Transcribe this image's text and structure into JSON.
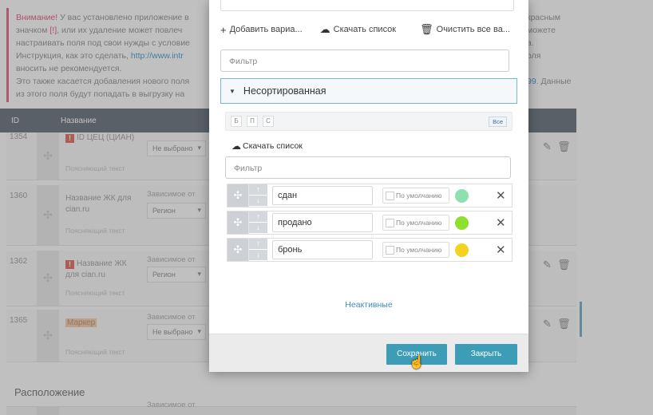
{
  "notice": {
    "warning": "Внимание!",
    "line1": " У вас установлено приложение в",
    "line2_a": "значком ",
    "line2_mark": "[!]",
    "line2_b": ", или их удаление может повлеч",
    "line3": "настраивать поля под свои нужды с условие",
    "line4_a": "Инструкция, как это сделать, ",
    "line4_link": "http://www.intr",
    "line5": "вносить не рекомендуется.",
    "line6": "Это также касается добавления нового поля",
    "line7": "из этого поля будут попадать в выгрузку на",
    "right1": "красным",
    "right2": "можете",
    "right3": "а.",
    "right4": "оля",
    "right6_link": "99",
    "right6": ". Данные"
  },
  "table": {
    "col_id": "ID",
    "col_name": "Название",
    "rows": [
      {
        "id": "1354",
        "name": "ID ЦЕЦ (ЦИАН)",
        "hint": "Поясняющий текст",
        "select": "Не выбрано"
      },
      {
        "id": "1360",
        "name": "Название ЖК для cian.ru",
        "hint": "Поясняющий текст",
        "dep": "Зависимое от",
        "select": "Регион"
      },
      {
        "id": "1362",
        "name": "Название ЖК для cian.ru",
        "hint": "Поясняющий текст",
        "dep": "Зависимое от",
        "select": "Регион"
      },
      {
        "id": "1365",
        "name": "Маркер",
        "hint": "Поясняющий текст",
        "dep": "Зависимое от",
        "select": "Не выбрано"
      }
    ]
  },
  "section": {
    "title": "Расположение",
    "dep": "Зависимое от"
  },
  "modal": {
    "toolbar": {
      "add": "Добавить вариа...",
      "download": "Скачать список",
      "clear": "Очистить все ва..."
    },
    "filter_placeholder": "Фильтр",
    "group": {
      "title": "Несортированная",
      "tabs": [
        "Б",
        "П",
        "С"
      ],
      "all": "Все",
      "download": "Скачать список",
      "filter_placeholder": "Фильтр",
      "values": [
        {
          "text": "сдан",
          "default_label": "По умолчанию",
          "color": "#8fe0b0"
        },
        {
          "text": "продано",
          "default_label": "По умолчанию",
          "color": "#8ee02e"
        },
        {
          "text": "бронь",
          "default_label": "По умолчанию",
          "color": "#f4d21f"
        }
      ]
    },
    "inactive": "Неактивные",
    "save": "Сохранить",
    "close": "Закрыть"
  }
}
